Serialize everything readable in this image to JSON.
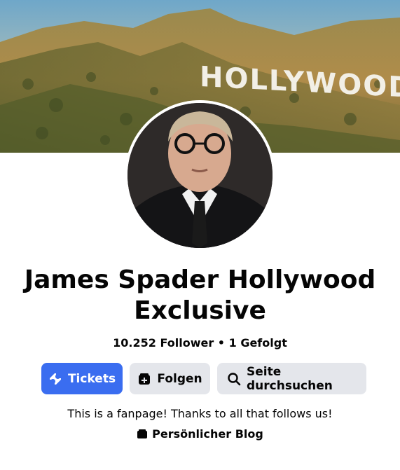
{
  "cover": {
    "sign_text": "HOLLYWOOD"
  },
  "profile": {
    "name": "James Spader Hollywood Exclusive",
    "followers": "10.252 Follower",
    "separator": "•",
    "following": "1 Gefolgt",
    "bio": "This is a fanpage! Thanks to all that follows us!",
    "category": "Persönlicher Blog"
  },
  "actions": {
    "tickets_label": "Tickets",
    "follow_label": "Folgen",
    "search_label": "Seite durchsuchen"
  },
  "colors": {
    "primary": "#3a6df0",
    "secondary": "#e4e6eb",
    "text": "#050505"
  },
  "icons": {
    "tickets": "ticket-icon",
    "follow": "follow-icon",
    "search": "search-icon",
    "category": "blog-icon"
  }
}
